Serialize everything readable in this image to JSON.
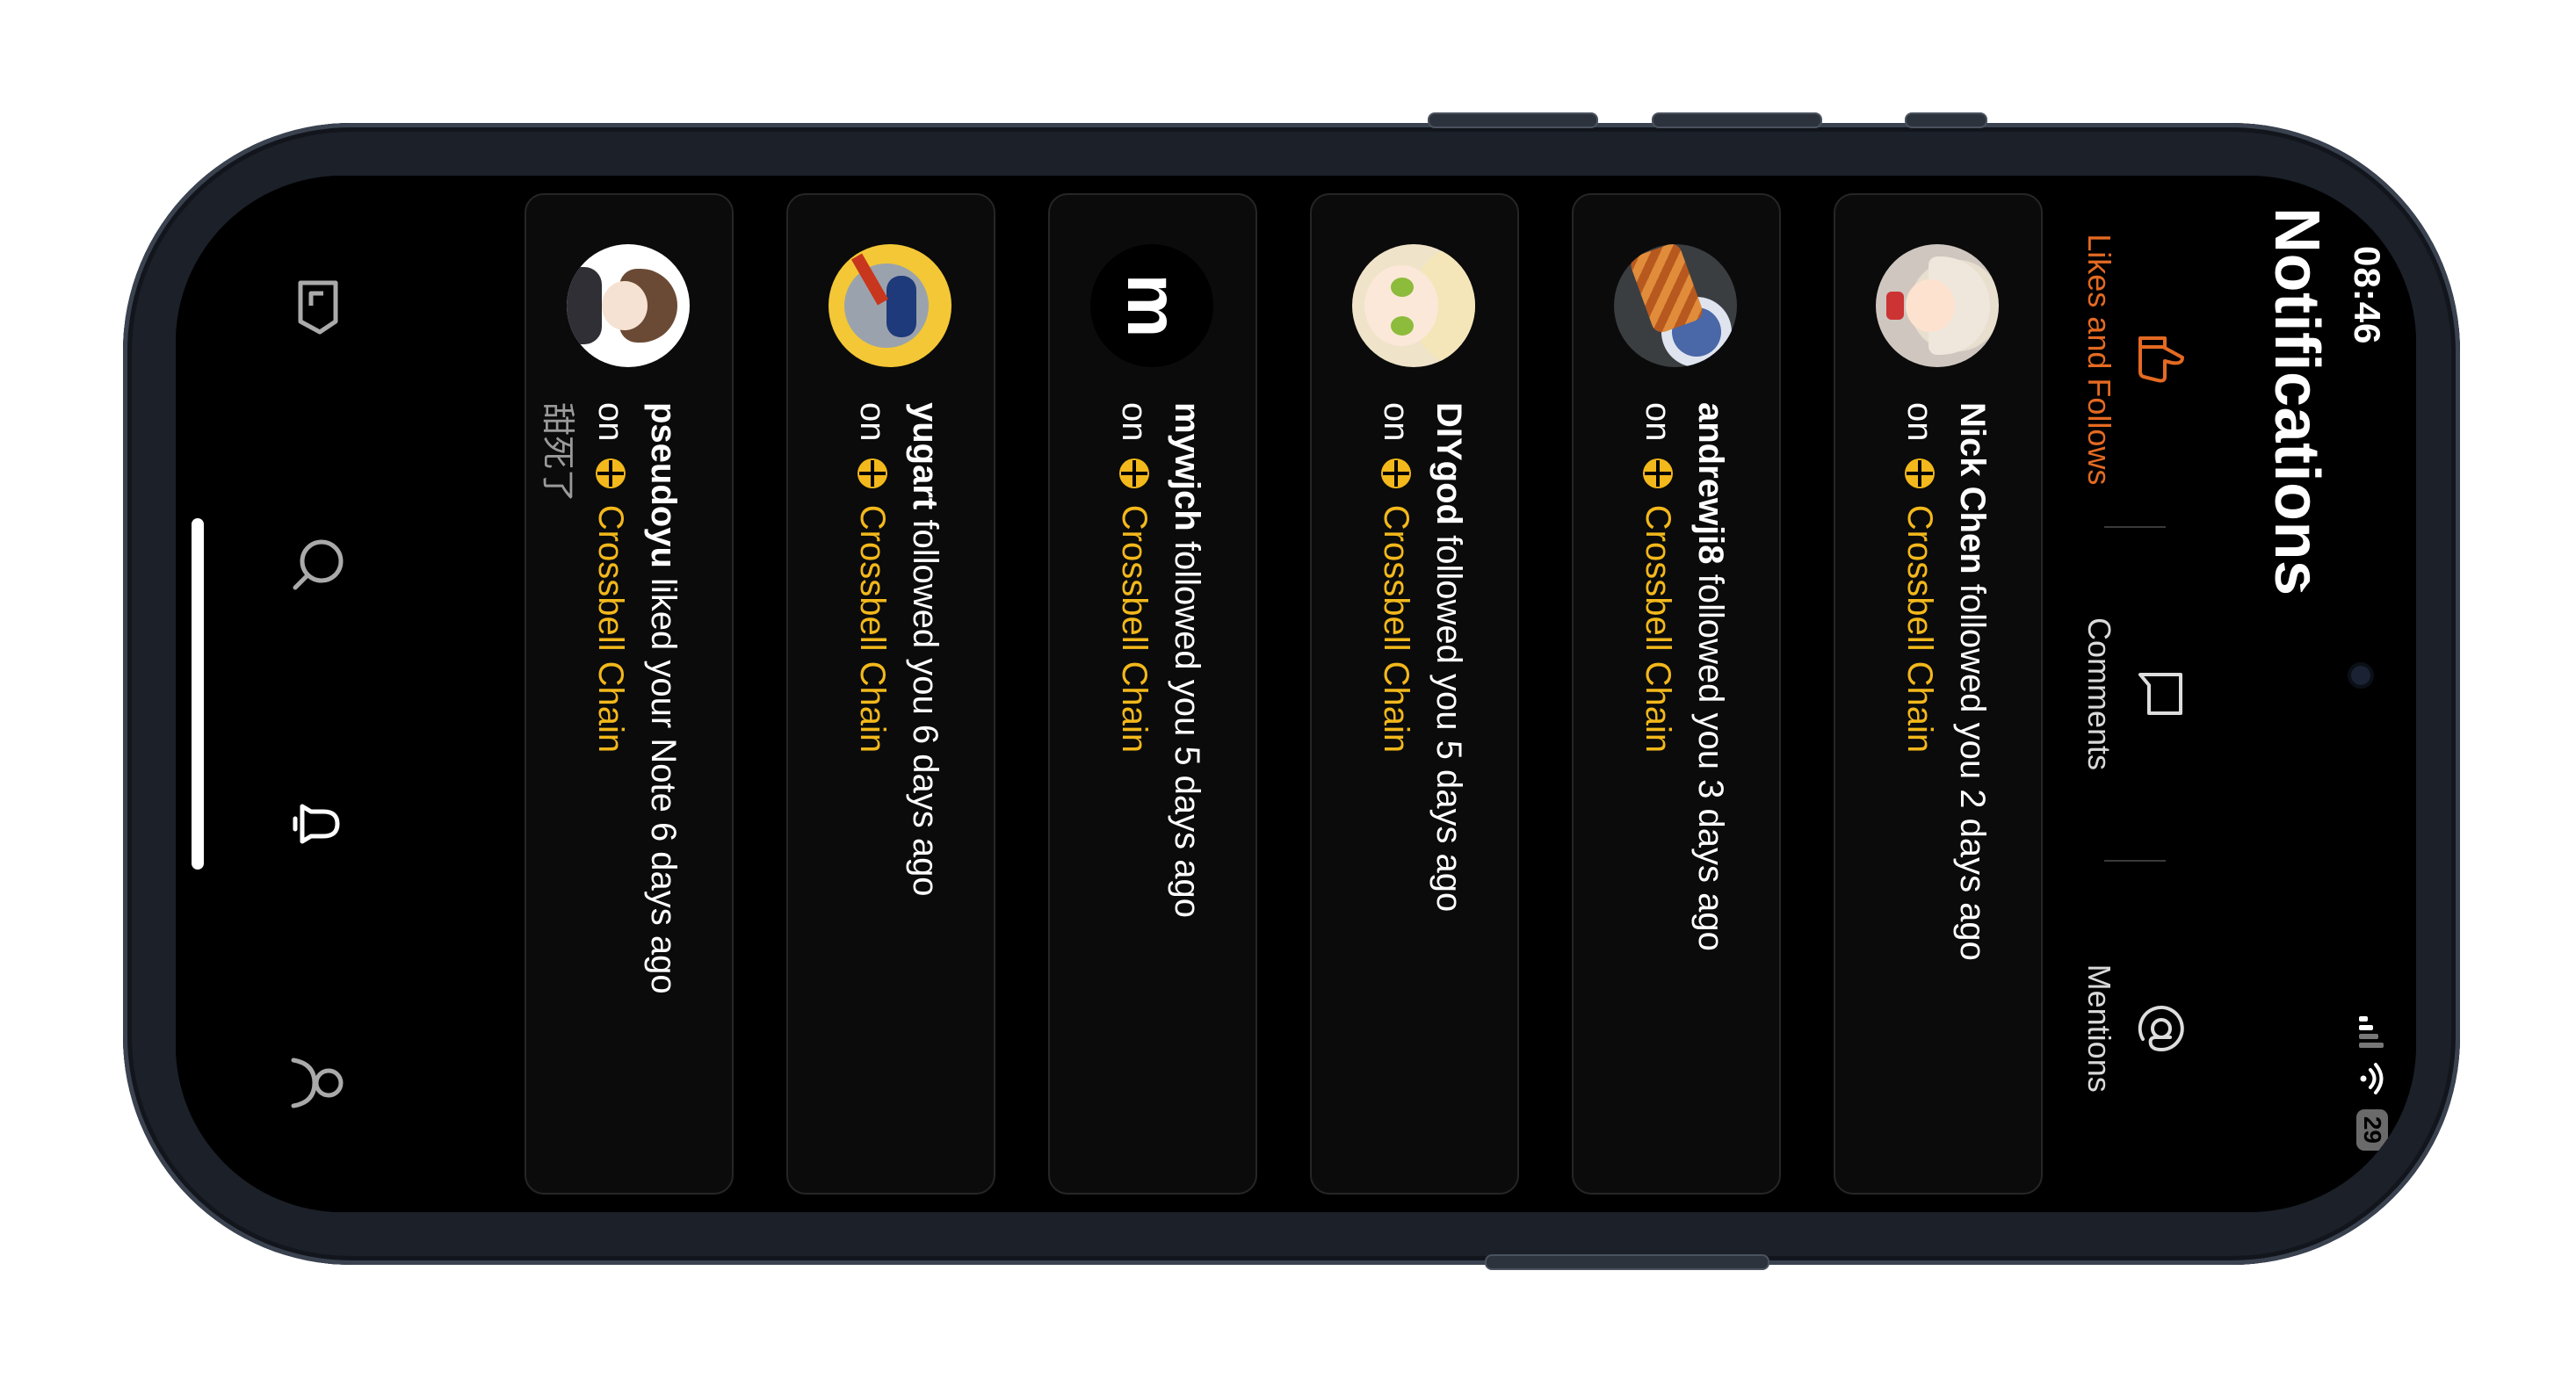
{
  "status": {
    "time": "08:46",
    "battery": "29"
  },
  "page_title": "Notifications",
  "tabs": [
    {
      "label": "Likes and Follows",
      "icon": "thumbs-up-icon",
      "active": true
    },
    {
      "label": "Comments",
      "icon": "comment-icon",
      "active": false
    },
    {
      "label": "Mentions",
      "icon": "at-sign-icon",
      "active": false
    }
  ],
  "notifications": [
    {
      "user": "Nick Chen",
      "action": "followed you 2 days ago",
      "on": "on",
      "chain": "Crossbell Chain",
      "avatar": "anime-girl-avatar"
    },
    {
      "user": "andrewji8",
      "action": "followed you 3 days ago",
      "on": "on",
      "chain": "Crossbell Chain",
      "avatar": "food-avatar"
    },
    {
      "user": "DIYgod",
      "action": "followed you 5 days ago",
      "on": "on",
      "chain": "Crossbell Chain",
      "avatar": "anime-girl-blonde-avatar"
    },
    {
      "user": "mywjch",
      "action": "followed you 5 days ago",
      "on": "on",
      "chain": "Crossbell Chain",
      "avatar": "m",
      "letter": "m"
    },
    {
      "user": "yugart",
      "action": "followed you 6 days ago",
      "on": "on",
      "chain": "Crossbell Chain",
      "avatar": "cartoon-avatar"
    },
    {
      "user": "pseudoyu",
      "action": "liked your Note 6 days ago",
      "on": "on",
      "chain": "Crossbell Chain",
      "avatar": "anime-boy-avatar",
      "sub": "甜死了"
    }
  ],
  "bottom_nav": [
    "home-icon",
    "search-icon",
    "bell-icon",
    "profile-icon"
  ],
  "colors": {
    "accent": "#e46a22",
    "chain": "#f3b81b",
    "background": "#000000",
    "card_border": "#262626"
  }
}
